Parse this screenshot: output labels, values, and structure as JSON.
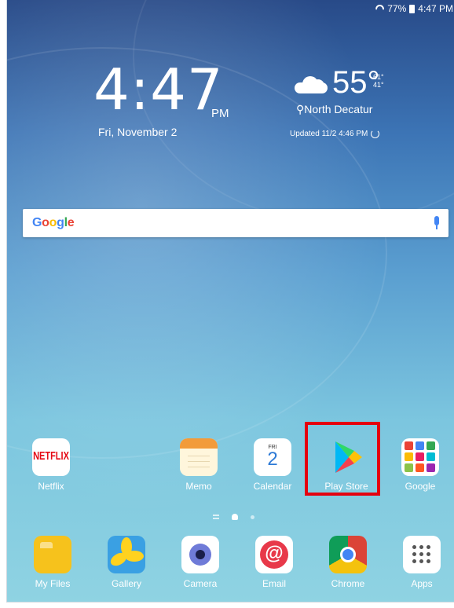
{
  "status": {
    "battery": "77%",
    "time": "4:47 PM"
  },
  "clock": {
    "time": "4:47",
    "ampm": "PM",
    "date": "Fri, November 2"
  },
  "weather": {
    "temp": "55°",
    "high": "61°",
    "low": "41°",
    "location": "North Decatur",
    "updated": "Updated 11/2 4:46 PM"
  },
  "search": {
    "brand": "Google"
  },
  "apps_row": [
    {
      "label": "Netflix",
      "icon_text": "NETFLIX"
    },
    {
      "label": "Memo"
    },
    {
      "label": "Calendar",
      "day": "FRI",
      "date": "2"
    },
    {
      "label": "Play Store"
    },
    {
      "label": "Google"
    }
  ],
  "dock": [
    {
      "label": "My Files"
    },
    {
      "label": "Gallery"
    },
    {
      "label": "Camera"
    },
    {
      "label": "Email"
    },
    {
      "label": "Chrome"
    },
    {
      "label": "Apps"
    }
  ],
  "colors": {
    "highlight": "#e4000f",
    "netflix": "#e50914"
  }
}
